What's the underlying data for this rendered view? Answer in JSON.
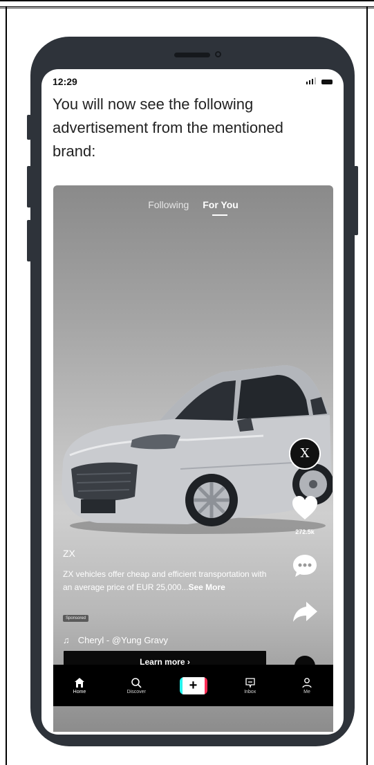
{
  "status_bar": {
    "time": "12:29"
  },
  "intro_text": "You will now see the following advertisement from the mentioned brand:",
  "feed_tabs": {
    "following": "Following",
    "for_you": "For You"
  },
  "brand_avatar_text": "Ⅹ",
  "actions": {
    "like_count": "272.5k"
  },
  "caption": {
    "username": "ZX",
    "text": "ZX vehicles offer cheap and efficient transportation with an average price of EUR 25,000...",
    "see_more": "See More",
    "sponsored": "Sponsored"
  },
  "music": {
    "note_icon": "♫",
    "track": "Cheryl - @Yung Gravy"
  },
  "cta": {
    "label": "Learn more ›"
  },
  "bottom_nav": {
    "home": "Home",
    "discover": "Discover",
    "create": "+",
    "inbox": "Inbox",
    "me": "Me"
  },
  "colors": {
    "phone_frame": "#2e333a",
    "nav_background": "#000000",
    "create_left_accent": "#25f4ee",
    "create_right_accent": "#fe2c55"
  }
}
